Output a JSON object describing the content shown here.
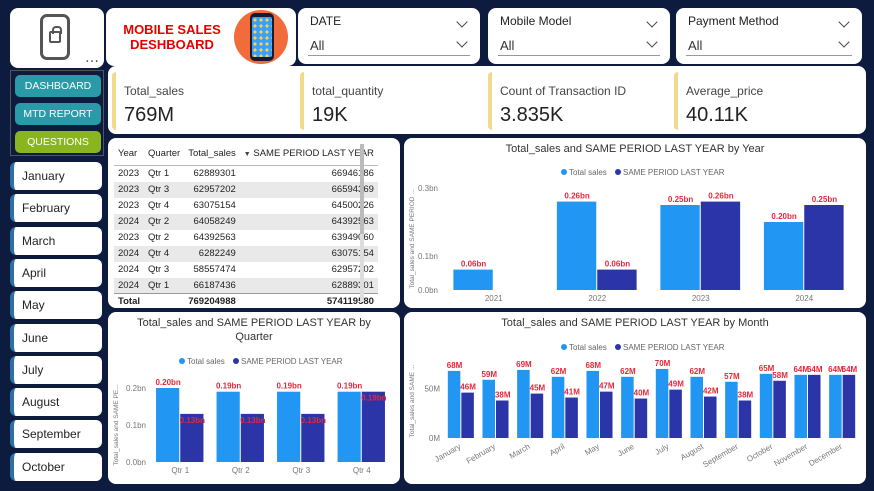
{
  "header": {
    "title_line1": "MOBILE SALES",
    "title_line2": "DESHBOARD"
  },
  "filters": [
    {
      "label": "DATE",
      "value": "All"
    },
    {
      "label": "Mobile Model",
      "value": "All"
    },
    {
      "label": "Payment Method",
      "value": "All"
    }
  ],
  "nav": [
    {
      "label": "DASHBOARD",
      "color": "#2a9aa8"
    },
    {
      "label": "MTD REPORT",
      "color": "#2a9aa8"
    },
    {
      "label": "QUESTIONS",
      "color": "#8ab520"
    }
  ],
  "months": [
    "January",
    "February",
    "March",
    "April",
    "May",
    "June",
    "July",
    "August",
    "September",
    "October"
  ],
  "kpis": [
    {
      "label": "Total_sales",
      "value": "769M"
    },
    {
      "label": "total_quantity",
      "value": "19K"
    },
    {
      "label": "Count of Transaction ID",
      "value": "3.835K"
    },
    {
      "label": "Average_price",
      "value": "40.11K"
    }
  ],
  "table": {
    "headers": [
      "Year",
      "Quarter",
      "Total_sales",
      "SAME PERIOD LAST YEAR"
    ],
    "rows": [
      [
        "2023",
        "Qtr 1",
        "62889301",
        "66946186"
      ],
      [
        "2023",
        "Qtr 3",
        "62957202",
        "66594369"
      ],
      [
        "2023",
        "Qtr 4",
        "63075154",
        "64500226"
      ],
      [
        "2024",
        "Qtr 2",
        "64058249",
        "64392563"
      ],
      [
        "2023",
        "Qtr 2",
        "64392563",
        "63949060"
      ],
      [
        "2024",
        "Qtr 4",
        "6282249",
        "63075154"
      ],
      [
        "2024",
        "Qtr 3",
        "58557474",
        "62957202"
      ],
      [
        "2024",
        "Qtr 1",
        "66187436",
        "62889301"
      ]
    ],
    "total": [
      "Total",
      "",
      "769204988",
      "574119580"
    ]
  },
  "colors": {
    "total_sales": "#2196f3",
    "same_period": "#2b35a8"
  },
  "chart_data": [
    {
      "type": "bar",
      "title": "Total_sales and SAME PERIOD LAST YEAR by Year",
      "ylabel": "Total_sales and SAME PERIOD ...",
      "categories": [
        "2021",
        "2022",
        "2023",
        "2024"
      ],
      "series": [
        {
          "name": "Total sales",
          "values": [
            0.06,
            0.26,
            0.25,
            0.2
          ],
          "labels": [
            "0.06bn",
            "0.26bn",
            "0.25bn",
            "0.20bn"
          ]
        },
        {
          "name": "SAME PERIOD LAST YEAR",
          "values": [
            null,
            0.06,
            0.26,
            0.25
          ],
          "labels": [
            "",
            "0.06bn",
            "0.26bn",
            "0.25bn"
          ]
        }
      ],
      "yticks": [
        "0.0bn",
        "0.1bn",
        "0.3bn"
      ],
      "ytick_values": [
        0,
        0.1,
        0.3
      ],
      "ylim": [
        0,
        0.3
      ]
    },
    {
      "type": "bar",
      "title_line1": "Total_sales and SAME PERIOD LAST YEAR by",
      "title_line2": "Quarter",
      "ylabel": "Total_sales and SAME PE...",
      "categories": [
        "Qtr 1",
        "Qtr 2",
        "Qtr 3",
        "Qtr 4"
      ],
      "series": [
        {
          "name": "Total sales",
          "values": [
            0.2,
            0.19,
            0.19,
            0.19
          ],
          "labels": [
            "0.20bn",
            "0.19bn",
            "0.19bn",
            "0.19bn"
          ]
        },
        {
          "name": "SAME PERIOD LAST YEAR",
          "values": [
            0.13,
            0.13,
            0.13,
            0.19
          ],
          "labels": [
            "0.13bn",
            "0.13bn",
            "0.13bn",
            "0.19bn"
          ]
        }
      ],
      "yticks": [
        "0.0bn",
        "0.1bn",
        "0.2bn"
      ],
      "ytick_values": [
        0,
        0.1,
        0.2
      ],
      "ylim": [
        0,
        0.2
      ]
    },
    {
      "type": "bar",
      "title": "Total_sales and SAME PERIOD LAST YEAR by Month",
      "ylabel": "Total_sales and SAME ...",
      "categories": [
        "January",
        "February",
        "March",
        "April",
        "May",
        "June",
        "July",
        "August",
        "September",
        "October",
        "November",
        "December"
      ],
      "series": [
        {
          "name": "Total sales",
          "values": [
            68,
            59,
            69,
            62,
            68,
            62,
            70,
            62,
            57,
            65,
            64,
            64
          ],
          "labels": [
            "68M",
            "59M",
            "69M",
            "62M",
            "68M",
            "62M",
            "70M",
            "62M",
            "57M",
            "65M",
            "64M",
            "64M"
          ]
        },
        {
          "name": "SAME PERIOD LAST YEAR",
          "values": [
            46,
            38,
            45,
            41,
            47,
            40,
            49,
            42,
            38,
            58,
            64,
            64
          ],
          "labels": [
            "46M",
            "38M",
            "45M",
            "41M",
            "47M",
            "40M",
            "49M",
            "42M",
            "38M",
            "58M",
            "64M",
            "64M"
          ]
        }
      ],
      "yticks": [
        "0M",
        "50M"
      ],
      "ytick_values": [
        0,
        50
      ],
      "ylim": [
        0,
        75
      ]
    }
  ],
  "legend": {
    "a": "Total sales",
    "b": "SAME PERIOD LAST YEAR"
  }
}
